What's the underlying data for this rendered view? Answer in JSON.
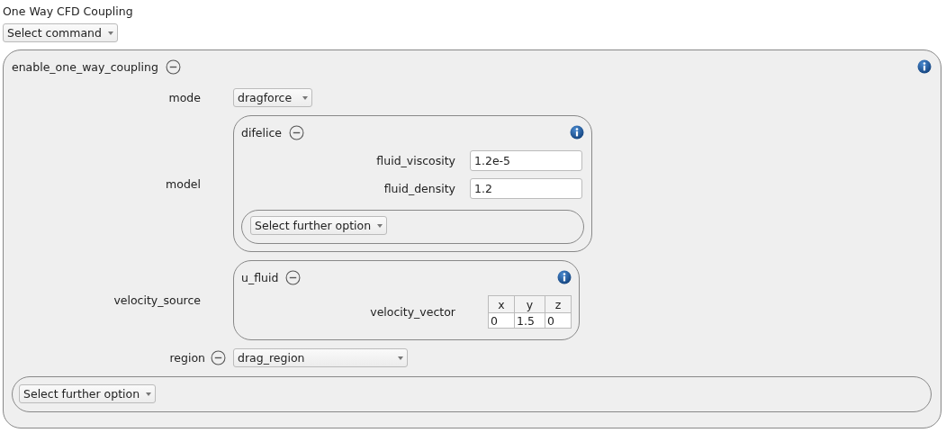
{
  "title": "One Way CFD Coupling",
  "command_select": {
    "label": "Select command"
  },
  "group": {
    "name": "enable_one_way_coupling",
    "params": [
      {
        "kind": "select",
        "label": "mode",
        "removable": false,
        "value": "dragforce",
        "wide": false
      },
      {
        "kind": "object",
        "label": "model",
        "object": {
          "name": "difelice",
          "fields": [
            {
              "kind": "text",
              "label": "fluid_viscosity",
              "value": "1.2e-5"
            },
            {
              "kind": "text",
              "label": "fluid_density",
              "value": "1.2"
            }
          ],
          "further": "Select further option"
        }
      },
      {
        "kind": "object",
        "label": "velocity_source",
        "object": {
          "name": "u_fluid",
          "fields": [
            {
              "kind": "vector",
              "label": "velocity_vector",
              "columns": [
                "x",
                "y",
                "z"
              ],
              "values": [
                "0",
                "1.5",
                "0"
              ]
            }
          ]
        }
      },
      {
        "kind": "select",
        "label": "region",
        "removable": true,
        "value": "drag_region",
        "wide": true
      }
    ],
    "further": "Select further option"
  }
}
